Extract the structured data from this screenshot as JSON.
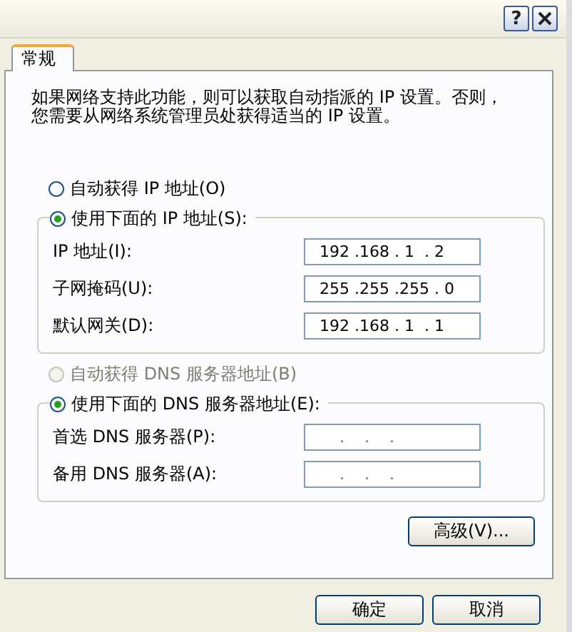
{
  "title_bar": {
    "help_button": "?"
  },
  "tabs": [
    {
      "label": "常规",
      "selected": true
    }
  ],
  "description": "如果网络支持此功能，则可以获取自动指派的 IP 设置。否则，您需要从网络系统管理员处获得适当的 IP 设置。",
  "ip": {
    "options": [
      {
        "label": "自动获得 IP 地址(O)",
        "selected": false,
        "disabled": false
      },
      {
        "label": "使用下面的 IP 地址(S):",
        "selected": true,
        "disabled": false
      }
    ],
    "fields": [
      {
        "label": "IP 地址(I):",
        "value": "192 .168 . 1  . 2"
      },
      {
        "label": "子网掩码(U):",
        "value": "255 .255 .255 . 0"
      },
      {
        "label": "默认网关(D):",
        "value": "192 .168 . 1  . 1"
      }
    ]
  },
  "dns": {
    "options": [
      {
        "label": "自动获得 DNS 服务器地址(B)",
        "selected": false,
        "disabled": true
      },
      {
        "label": "使用下面的 DNS 服务器地址(E):",
        "selected": true,
        "disabled": false
      }
    ],
    "fields": [
      {
        "label": "首选 DNS 服务器(P):",
        "value": "    .    .    ."
      },
      {
        "label": "备用 DNS 服务器(A):",
        "value": "    .    .    ."
      }
    ]
  },
  "advanced_button": "高级(V)...",
  "buttons": [
    "确定",
    "取消"
  ]
}
